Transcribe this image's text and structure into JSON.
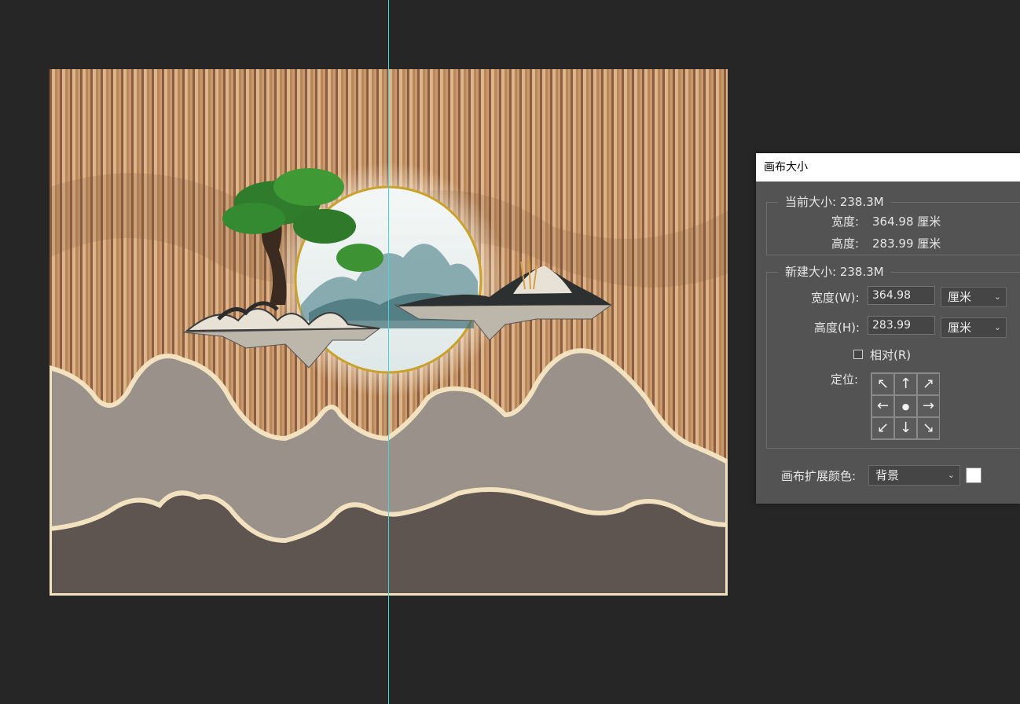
{
  "dialog": {
    "title": "画布大小",
    "current_size": {
      "legend": "当前大小: 238.3M",
      "width_label": "宽度:",
      "width_value": "364.98 厘米",
      "height_label": "高度:",
      "height_value": "283.99 厘米"
    },
    "new_size": {
      "legend": "新建大小: 238.3M",
      "width_label": "宽度(W):",
      "width_value": "364.98",
      "width_unit": "厘米",
      "height_label": "高度(H):",
      "height_value": "283.99",
      "height_unit": "厘米",
      "relative_label": "相对(R)",
      "relative_checked": false,
      "anchor_label": "定位:",
      "anchor_arrows": [
        "↖",
        "↑",
        "↗",
        "←",
        "●",
        "→",
        "↙",
        "↓",
        "↘"
      ]
    },
    "extension": {
      "label": "画布扩展颜色:",
      "value": "背景",
      "swatch_color": "#ffffff"
    }
  },
  "guide_color": "#3fd6dc"
}
